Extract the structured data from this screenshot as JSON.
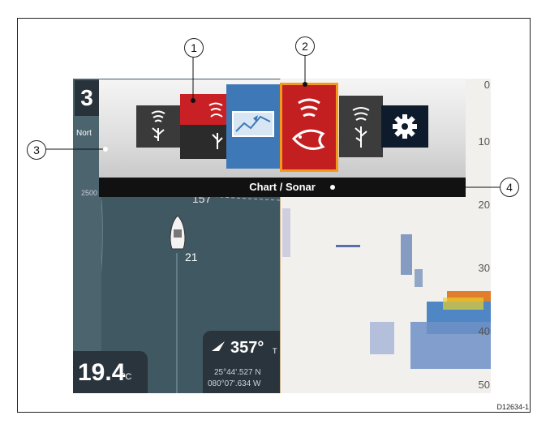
{
  "screen": {
    "depth_partial": "3",
    "north_label": "Nort",
    "contour_label": "2500",
    "spot_depth_1": "157",
    "spot_depth_2": "21",
    "temperature": {
      "value": "19.4",
      "unit": "°C"
    },
    "heading": {
      "value": "357°",
      "unit": "T",
      "lat": "25°44'.527 N",
      "lon": "080°07'.634 W"
    },
    "depth_scale": [
      "0",
      "10",
      "20",
      "30",
      "40",
      "50"
    ]
  },
  "home_screen": {
    "selected_label": "Chart / Sonar",
    "tiles": [
      {
        "name": "fishfinder",
        "icon": "fishfinder-icon"
      },
      {
        "name": "split-sonar",
        "icon": "split-sonar-icon"
      },
      {
        "name": "chart",
        "icon": "chart-icon"
      },
      {
        "name": "sonar",
        "icon": "sonar-fish-icon",
        "selected": true
      },
      {
        "name": "fishfinder",
        "icon": "fishfinder-icon"
      },
      {
        "name": "settings",
        "icon": "gear-icon"
      }
    ]
  },
  "callouts": [
    "1",
    "2",
    "3",
    "4"
  ],
  "figure_id": "D12634-1",
  "colors": {
    "accent": "#f39a1c",
    "sonar_red": "#c41f20",
    "chart_blue": "#3f78b6"
  }
}
